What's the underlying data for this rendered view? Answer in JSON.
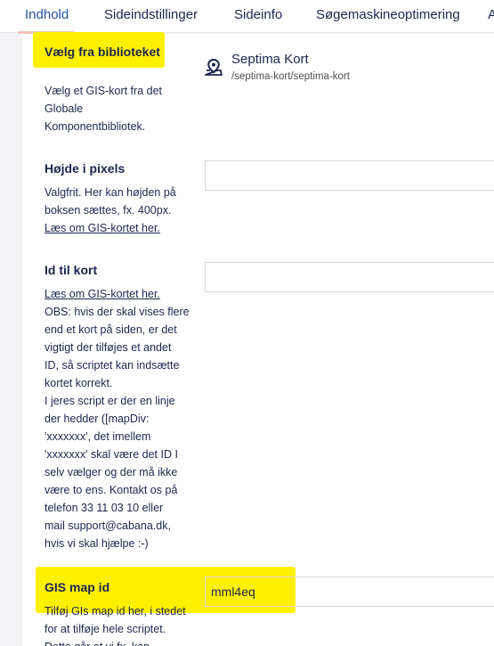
{
  "tabs": [
    {
      "label": "Indhold",
      "active": true
    },
    {
      "label": "Sideindstillinger"
    },
    {
      "label": "Sideinfo"
    },
    {
      "label": "Søgemaskineoptimering"
    }
  ],
  "tab_overflow_label": "A",
  "fields": {
    "library": {
      "label": "Vælg fra biblioteket",
      "description_lines": [
        "Vælg et GIS-kort fra det",
        "Globale",
        "Komponentbibliotek."
      ],
      "picked_name": "Septima Kort",
      "picked_path": "/septima-kort/septima-kort"
    },
    "height": {
      "label": "Højde i pixels",
      "description_lines": [
        "Valgfrit. Her kan højden på",
        "boksen sættes, fx. 400px."
      ],
      "link": "Læs om GIS-kortet her.",
      "value": ""
    },
    "map_id": {
      "label": "Id til kort",
      "link": "Læs om GIS-kortet her.",
      "description_lines": [
        "OBS: hvis der skal vises flere",
        "end et kort på siden, er det",
        "vigtigt der tilføjes et andet",
        "ID, så scriptet kan indsætte",
        "kortet korrekt.",
        "I jeres script er der en linje",
        "der hedder ([mapDiv:",
        "'xxxxxxx', det imellem",
        "'xxxxxxx' skal være det ID I",
        "selv vælger og der må ikke",
        "være to ens. Kontakt os på",
        "telefon 33 11 03 10 eller",
        "mail support@cabana.dk,",
        "hvis vi skal hjælpe :-)"
      ],
      "value": ""
    },
    "gis_map_id": {
      "label": "GIS map id",
      "description_lines": [
        "Tilføj GIs map id her, i stedet",
        "for at tilføje hele scriptet.",
        "Dette går at vi fx. kan"
      ],
      "value": "mml4eq"
    }
  },
  "colors": {
    "highlight": "#fff000",
    "text": "#1b264f",
    "active_tab": "#2152a3",
    "tab_indicator": "#f5c1bc"
  },
  "icons": {
    "picked_item": "map-marker-icon"
  }
}
